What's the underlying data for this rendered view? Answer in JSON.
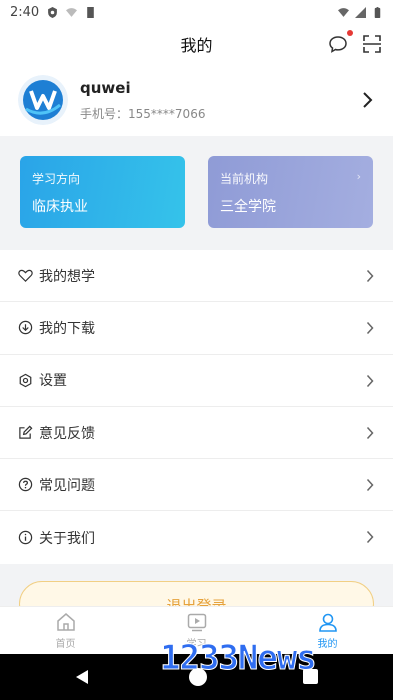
{
  "status_bar": {
    "time": "2:40"
  },
  "header": {
    "title": "我的"
  },
  "profile": {
    "name": "quwei",
    "phone_label": "手机号：",
    "phone": "155****7066"
  },
  "cards": {
    "study": {
      "label": "学习方向",
      "value": "临床执业"
    },
    "org": {
      "label": "当前机构",
      "value": "三全学院",
      "more": "›"
    }
  },
  "menu": {
    "items": [
      {
        "label": "我的想学",
        "icon": "heart-icon"
      },
      {
        "label": "我的下载",
        "icon": "download-icon"
      },
      {
        "label": "设置",
        "icon": "settings-icon"
      },
      {
        "label": "意见反馈",
        "icon": "feedback-icon"
      },
      {
        "label": "常见问题",
        "icon": "question-icon"
      },
      {
        "label": "关于我们",
        "icon": "info-icon"
      }
    ]
  },
  "logout": {
    "label": "退出登录"
  },
  "tabbar": {
    "tabs": [
      {
        "label": "首页",
        "icon": "home-icon",
        "active": false
      },
      {
        "label": "学习",
        "icon": "play-icon",
        "active": false
      },
      {
        "label": "我的",
        "icon": "user-icon",
        "active": true
      }
    ]
  },
  "watermark": {
    "text": "1233News"
  },
  "colors": {
    "accent": "#2196f3",
    "study_card": "#2aa4e8",
    "org_card": "#8f9bd6",
    "logout_text": "#e6a23c",
    "badge": "#e53935"
  }
}
